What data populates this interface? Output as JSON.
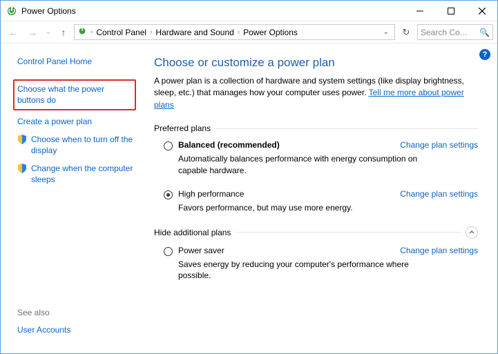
{
  "window": {
    "title": "Power Options"
  },
  "breadcrumbs": {
    "items": [
      "Control Panel",
      "Hardware and Sound",
      "Power Options"
    ]
  },
  "search": {
    "placeholder": "Search Co..."
  },
  "sidebar": {
    "home": "Control Panel Home",
    "items": [
      {
        "label": "Choose what the power buttons do",
        "highlighted": true
      },
      {
        "label": "Create a power plan"
      },
      {
        "label": "Choose when to turn off the display"
      },
      {
        "label": "Change when the computer sleeps"
      }
    ],
    "see_also_heading": "See also",
    "see_also": [
      "User Accounts"
    ]
  },
  "main": {
    "heading": "Choose or customize a power plan",
    "intro_prefix": "A power plan is a collection of hardware and system settings (like display brightness, sleep, etc.) that manages how your computer uses power. ",
    "intro_link": "Tell me more about power plans",
    "preferred_heading": "Preferred plans",
    "hide_heading": "Hide additional plans",
    "change_label": "Change plan settings",
    "plans": {
      "balanced": {
        "name": "Balanced (recommended)",
        "desc": "Automatically balances performance with energy consumption on capable hardware."
      },
      "high": {
        "name": "High performance",
        "desc": "Favors performance, but may use more energy."
      },
      "saver": {
        "name": "Power saver",
        "desc": "Saves energy by reducing your computer's performance where possible."
      }
    }
  },
  "help": "?"
}
